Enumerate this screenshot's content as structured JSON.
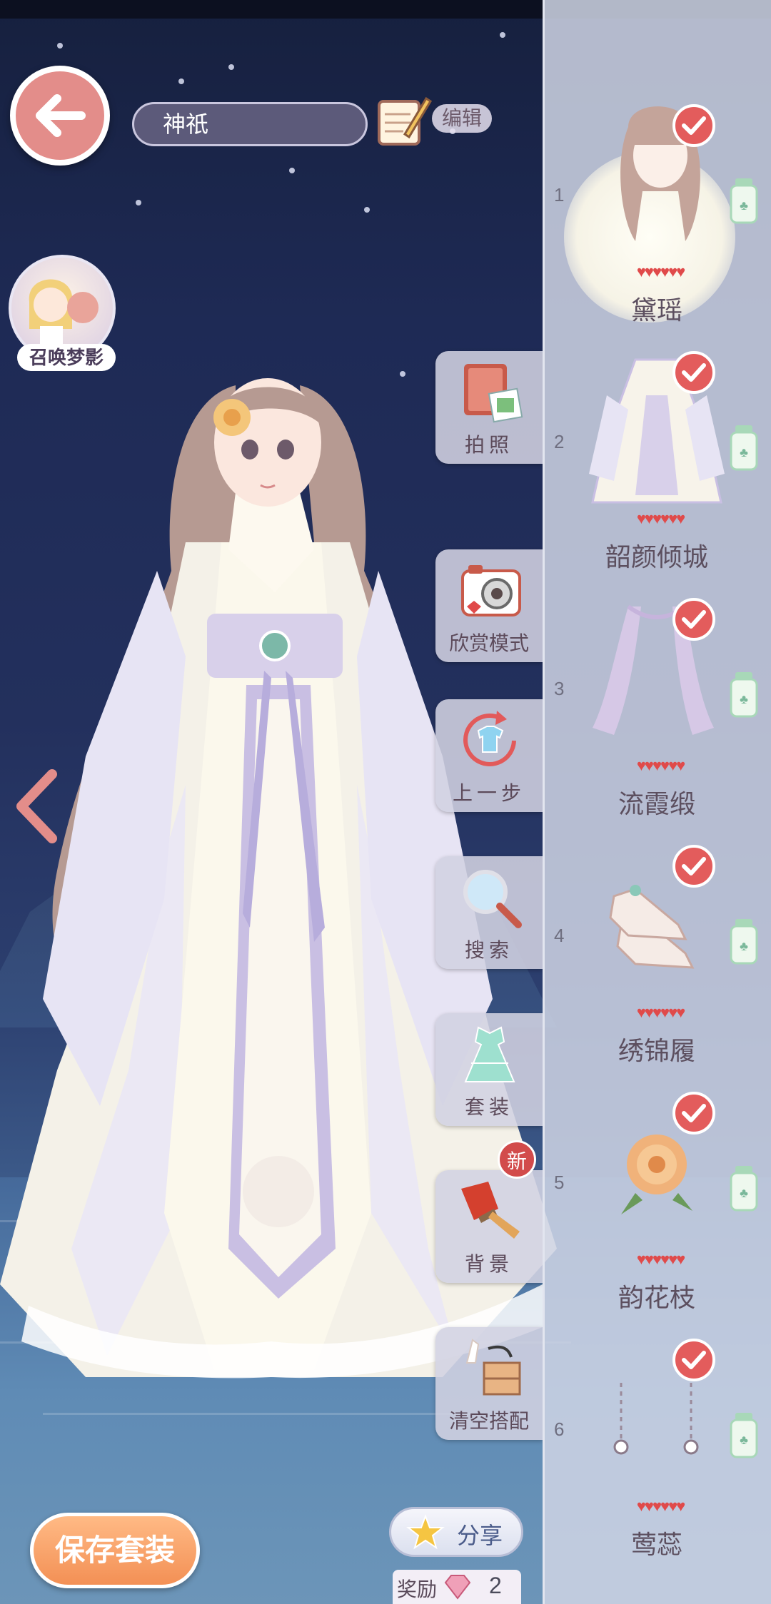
{
  "header": {
    "outfit_name": "神祇",
    "edit_label": "编辑"
  },
  "summon": {
    "label": "召唤梦影"
  },
  "tools": [
    {
      "key": "photo",
      "label": "拍照"
    },
    {
      "key": "view_mode",
      "label": "欣赏模式"
    },
    {
      "key": "undo",
      "label": "上一步"
    },
    {
      "key": "search",
      "label": "搜索"
    },
    {
      "key": "suit",
      "label": "套装"
    },
    {
      "key": "background",
      "label": "背景",
      "badge": "新"
    },
    {
      "key": "clear",
      "label": "清空搭配"
    }
  ],
  "footer": {
    "save_label": "保存套装",
    "share_label": "分享",
    "reward_label": "奖励",
    "reward_count": "2"
  },
  "items": [
    {
      "index": "1",
      "name": "黛瑶",
      "hearts": "♥♥♥♥♥♥",
      "category": "hair"
    },
    {
      "index": "2",
      "name": "韶颜倾城",
      "hearts": "♥♥♥♥♥♥",
      "category": "dress"
    },
    {
      "index": "3",
      "name": "流霞缎",
      "hearts": "♥♥♥♥♥♥",
      "category": "sash"
    },
    {
      "index": "4",
      "name": "绣锦履",
      "hearts": "♥♥♥♥♥♥",
      "category": "shoes"
    },
    {
      "index": "5",
      "name": "韵花枝",
      "hearts": "♥♥♥♥♥♥",
      "category": "hairpin"
    },
    {
      "index": "6",
      "name": "莺蕊",
      "hearts": "♥♥♥♥♥♥",
      "category": "earrings"
    }
  ],
  "colors": {
    "accent_red": "#e35c5c",
    "save_orange": "#f39055",
    "back_pink": "#e38d8a"
  }
}
